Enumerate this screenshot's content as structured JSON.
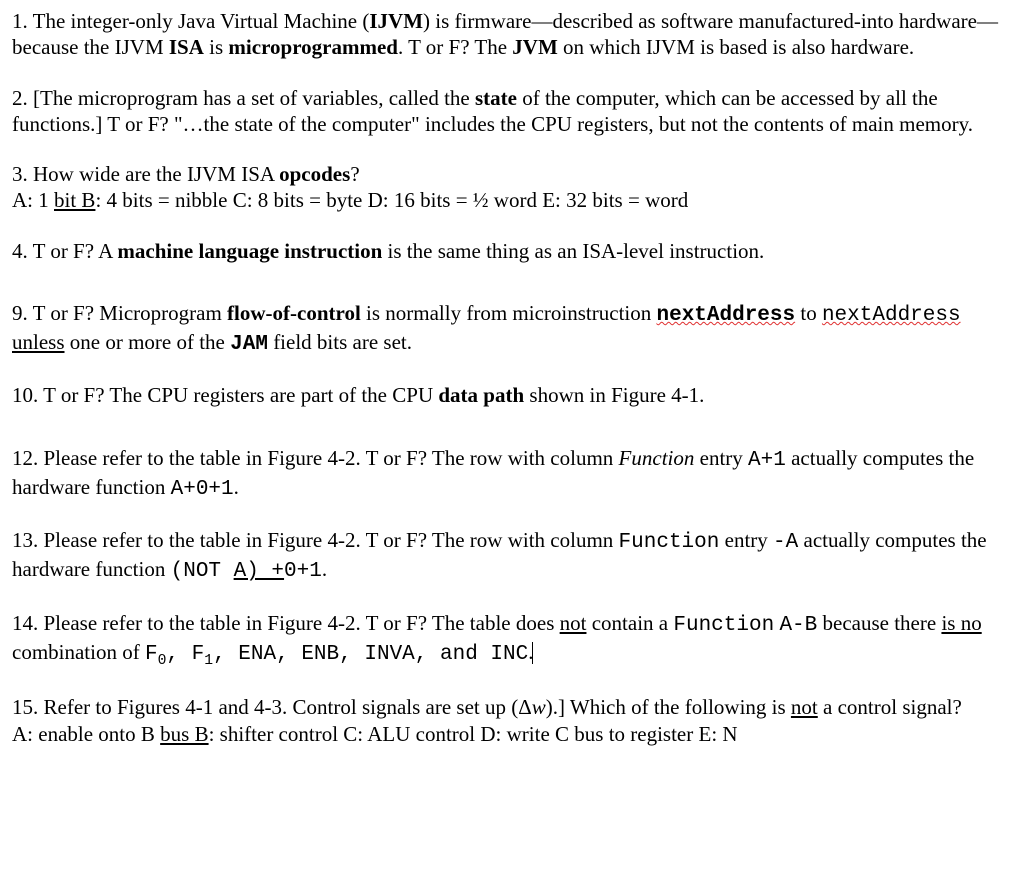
{
  "q1": {
    "num": "1.",
    "t1": " The integer-only Java Virtual Machine (",
    "t2": "IJVM",
    "t3": ") is firmware—described as software manufactured-into hardware—because the IJVM ",
    "t4": "ISA",
    "t5": " is ",
    "t6": "microprogrammed",
    "t7": ". T or F? The ",
    "t8": "JVM",
    "t9": " on which IJVM is based is also hardware."
  },
  "q2": {
    "num": "2.",
    "t1": " [The microprogram has a set of variables, called the ",
    "t2": "state",
    "t3": " of the computer, which can be accessed by all the functions.] T or F? \"…the state of the computer\" includes the CPU registers, but not the contents of main memory."
  },
  "q3": {
    "num": "3.",
    "t1": " How wide are the IJVM ISA ",
    "t2": "opcodes",
    "t3": "?",
    "a1": "A: 1 ",
    "a2": "bit  B",
    "a3": ": 4 bits = nibble  C: 8 bits = byte  D: 16 bits = ½ word  E: 32 bits = word"
  },
  "q4": {
    "num": "4.",
    "t1": " T or F? A ",
    "t2": "machine language instruction",
    "t3": " is the same thing as an ISA-level instruction."
  },
  "q9": {
    "num": "9.",
    "t1": " T or F? Microprogram ",
    "t2": "flow-of-control",
    "t3": " is normally from microinstruction ",
    "t4": "nextAddress",
    "t5": " to ",
    "t6": "nextAddress",
    "t7": " ",
    "t8": "unless",
    "t9": " one or more of the ",
    "t10": "JAM",
    "t11": " field bits are set."
  },
  "q10": {
    "num": "10.",
    "t1": " T or F? The CPU registers are part of the CPU ",
    "t2": "data path",
    "t3": " shown in Figure 4-1."
  },
  "q12": {
    "num": "12.",
    "t1": " Please refer to the table in Figure 4-2. T or F? The row with column ",
    "t2": "Function",
    "t3": " entry ",
    "t4": "A+1",
    "t5": " actually computes the hardware function ",
    "t6": "A+0+1",
    "t7": "."
  },
  "q13": {
    "num": "13.",
    "t1": " Please refer to the table in Figure 4-2. T or F? The row with column ",
    "t2": "Function",
    "t3": " entry ",
    "t4": "-A",
    "t5": " actually computes the hardware function ",
    "t6": "(NOT  ",
    "t7": "A) +",
    "t8": "0+1",
    "t9": "."
  },
  "q14": {
    "num": "14.",
    "t1": " Please refer to the table in Figure 4-2. T or F? The table does ",
    "t2": "not",
    "t3": " contain a ",
    "t4": "Function",
    "t5": " ",
    "t6": "A-B",
    "t7": " because there ",
    "t8": "is no",
    "t9": " combination of ",
    "f0": "F",
    "s0": "0",
    "c1": ", ",
    "f1": "F",
    "s1": "1",
    "c2": ", ",
    "t10": "ENA",
    "c3": ", ",
    "t11": "ENB",
    "c4": ", ",
    "t12": "INVA",
    "c5": ", and ",
    "t13": "INC",
    "t14": "."
  },
  "q15": {
    "num": "15.",
    "t1": " Refer to Figures 4-1 and 4-3. Control signals are set up (Δ",
    "t2": "w",
    "t3": ").] Which of the following is ",
    "t4": "not",
    "t5": " a control signal?",
    "a1": "A: enable onto B ",
    "a2": "bus  B",
    "a3": ": shifter control  C: ALU control  D: write C bus to register  E: N"
  }
}
